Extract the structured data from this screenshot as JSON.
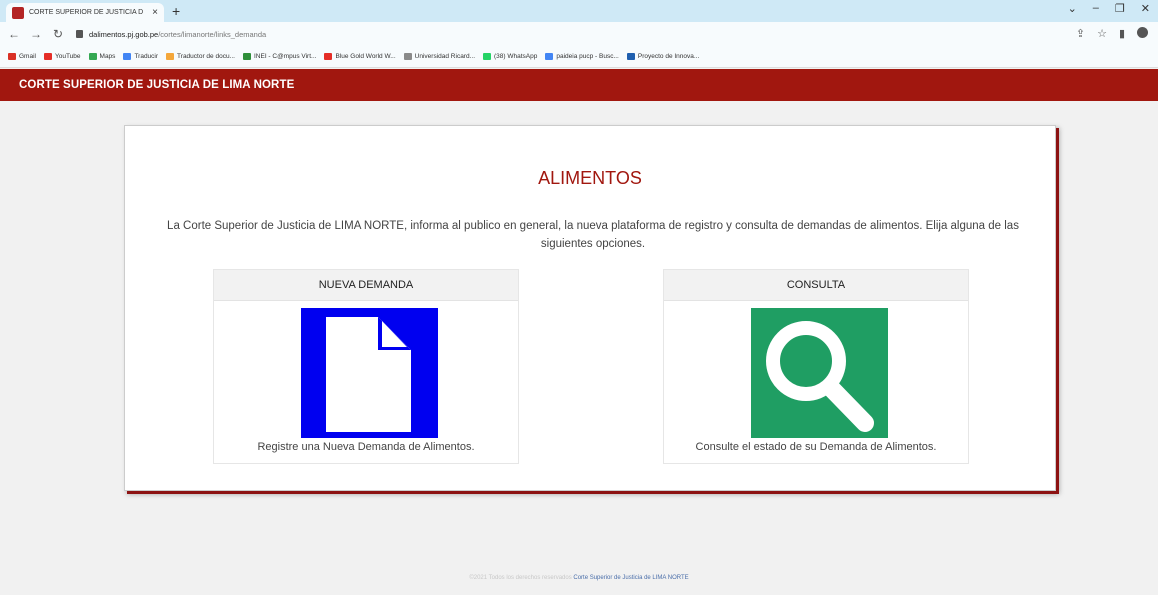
{
  "browser": {
    "tab_title": "CORTE SUPERIOR DE JUSTICIA D",
    "tab_close": "×",
    "new_tab": "+",
    "url_host": "dalimentos.pj.gob.pe",
    "url_path": "/cortes/limanorte/links_demanda",
    "bookmarks": [
      {
        "label": "Gmail",
        "color": "#d93025"
      },
      {
        "label": "YouTube",
        "color": "#e52d27"
      },
      {
        "label": "Maps",
        "color": "#34a853"
      },
      {
        "label": "Traducir",
        "color": "#4285f4"
      },
      {
        "label": "Traductor de docu...",
        "color": "#f4a73b"
      },
      {
        "label": "INEI - C@mpus Virt...",
        "color": "#2f8f3a"
      },
      {
        "label": "Blue Gold World W...",
        "color": "#e52d27"
      },
      {
        "label": "Universidad Ricard...",
        "color": "#8a8a8a"
      },
      {
        "label": "(38) WhatsApp",
        "color": "#25d366"
      },
      {
        "label": "paideia pucp - Busc...",
        "color": "#4285f4"
      },
      {
        "label": "Proyecto de Innova...",
        "color": "#1f5faf"
      }
    ]
  },
  "header": {
    "title": "CORTE SUPERIOR DE JUSTICIA DE LIMA NORTE"
  },
  "main": {
    "title": "ALIMENTOS",
    "description": "La Corte Superior de Justicia de LIMA NORTE, informa al publico en general, la nueva plataforma de registro y consulta de demandas de alimentos. Elija alguna de las siguientes opciones.",
    "options": [
      {
        "heading": "NUEVA DEMANDA",
        "caption": "Registre una Nueva Demanda de Alimentos.",
        "icon": "document-icon",
        "bg": "#0000f0"
      },
      {
        "heading": "CONSULTA",
        "caption": "Consulte el estado de su Demanda de Alimentos.",
        "icon": "magnifier-icon",
        "bg": "#1f9e63"
      }
    ]
  },
  "footer": {
    "text": "©2021 Todos los derechos reservados",
    "link": "Corte Superior de Justicia de LIMA NORTE"
  },
  "colors": {
    "brand": "#a1170f",
    "accent_blue": "#0000f0",
    "accent_green": "#1f9e63"
  }
}
